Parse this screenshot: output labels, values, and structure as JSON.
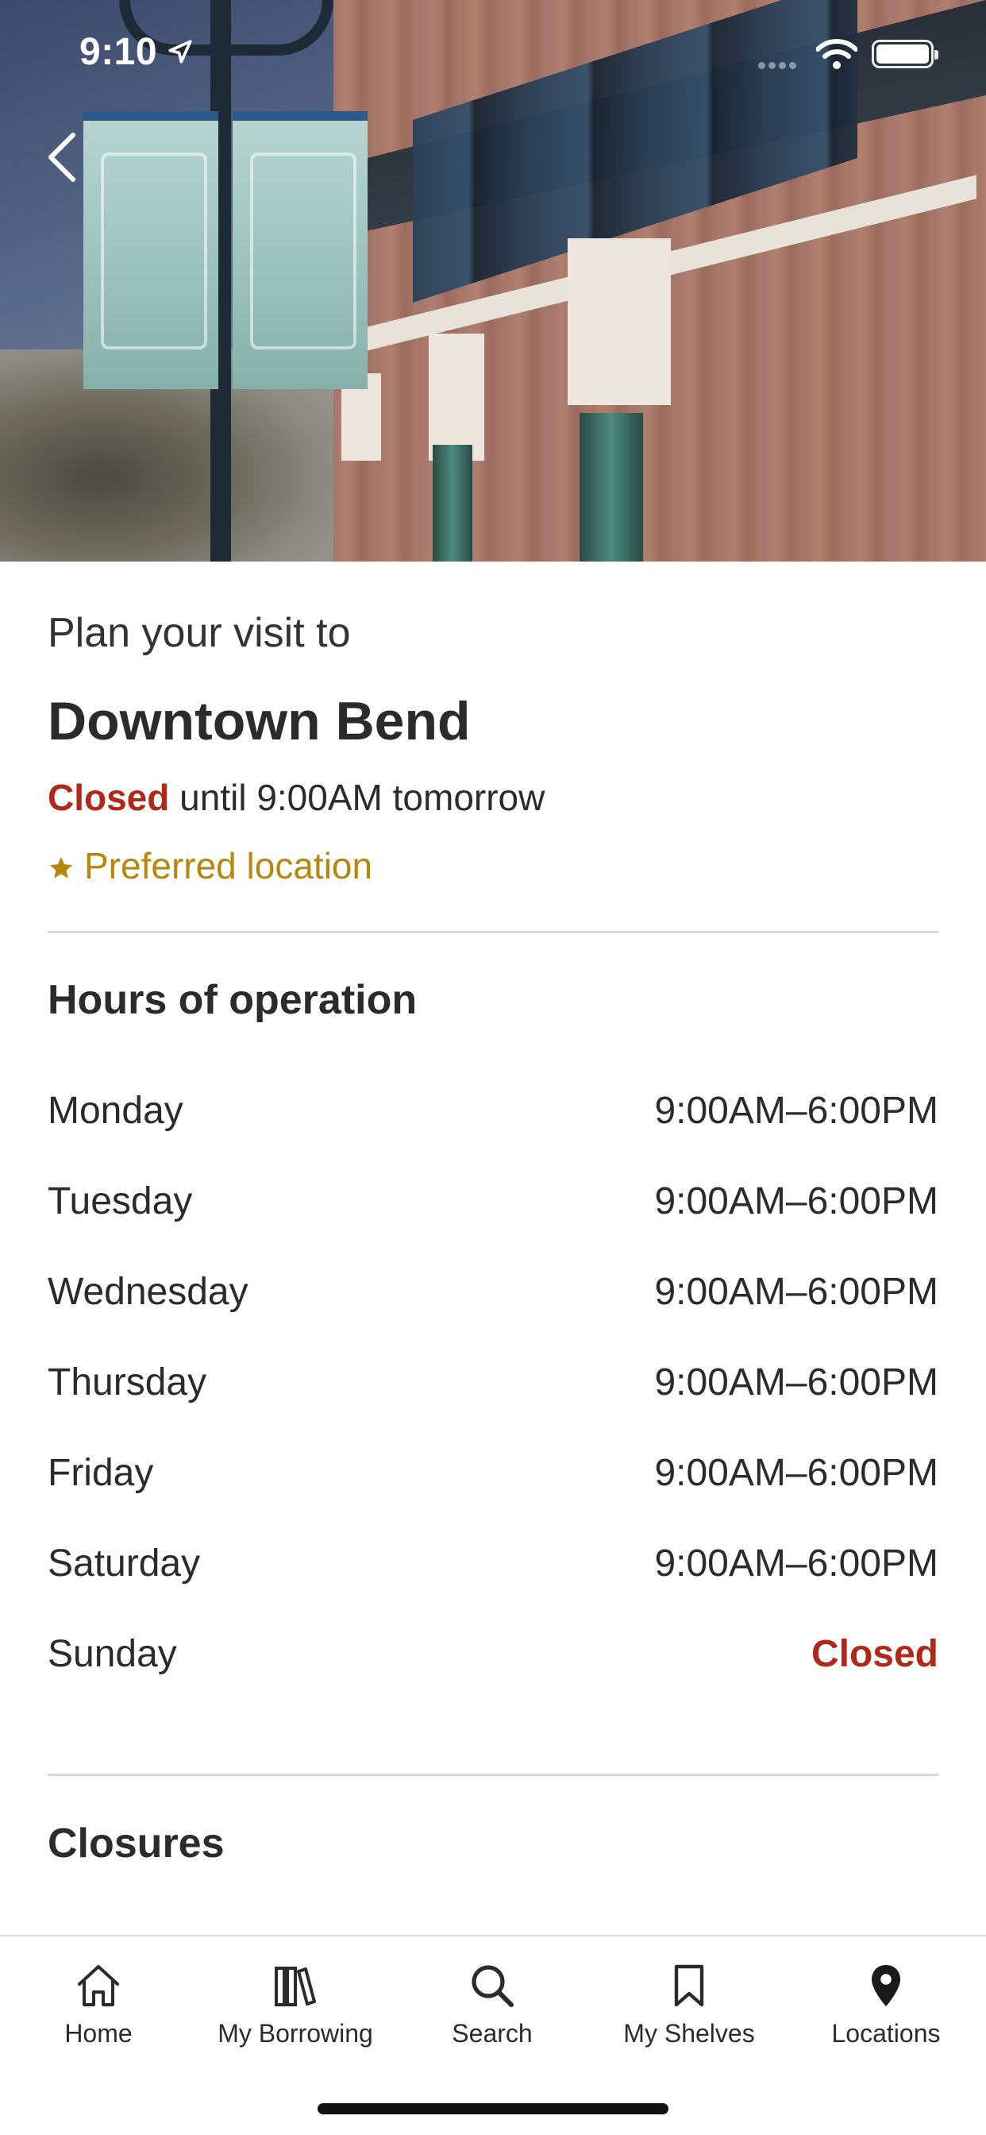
{
  "status_bar": {
    "time": "9:10"
  },
  "header": {
    "back_icon": "chevron-left-icon"
  },
  "location": {
    "intro": "Plan your visit to",
    "name": "Downtown Bend",
    "status_closed": "Closed",
    "status_rest": " until 9:00AM tomorrow",
    "preferred_label": "Preferred location",
    "preferred_icon": "star-icon",
    "closed_color": "#b0281a",
    "preferred_color": "#b8860b"
  },
  "hours": {
    "title": "Hours of operation",
    "rows": [
      {
        "day": "Monday",
        "time": "9:00AM–6:00PM"
      },
      {
        "day": "Tuesday",
        "time": "9:00AM–6:00PM"
      },
      {
        "day": "Wednesday",
        "time": "9:00AM–6:00PM"
      },
      {
        "day": "Thursday",
        "time": "9:00AM–6:00PM"
      },
      {
        "day": "Friday",
        "time": "9:00AM–6:00PM"
      },
      {
        "day": "Saturday",
        "time": "9:00AM–6:00PM"
      },
      {
        "day": "Sunday",
        "time": "Closed"
      }
    ]
  },
  "closures": {
    "title": "Closures"
  },
  "tabbar": {
    "tabs": [
      {
        "label": "Home",
        "icon": "home-icon"
      },
      {
        "label": "My Borrowing",
        "icon": "books-icon"
      },
      {
        "label": "Search",
        "icon": "search-icon"
      },
      {
        "label": "My Shelves",
        "icon": "bookmark-icon"
      },
      {
        "label": "Locations",
        "icon": "location-pin-icon"
      }
    ]
  }
}
